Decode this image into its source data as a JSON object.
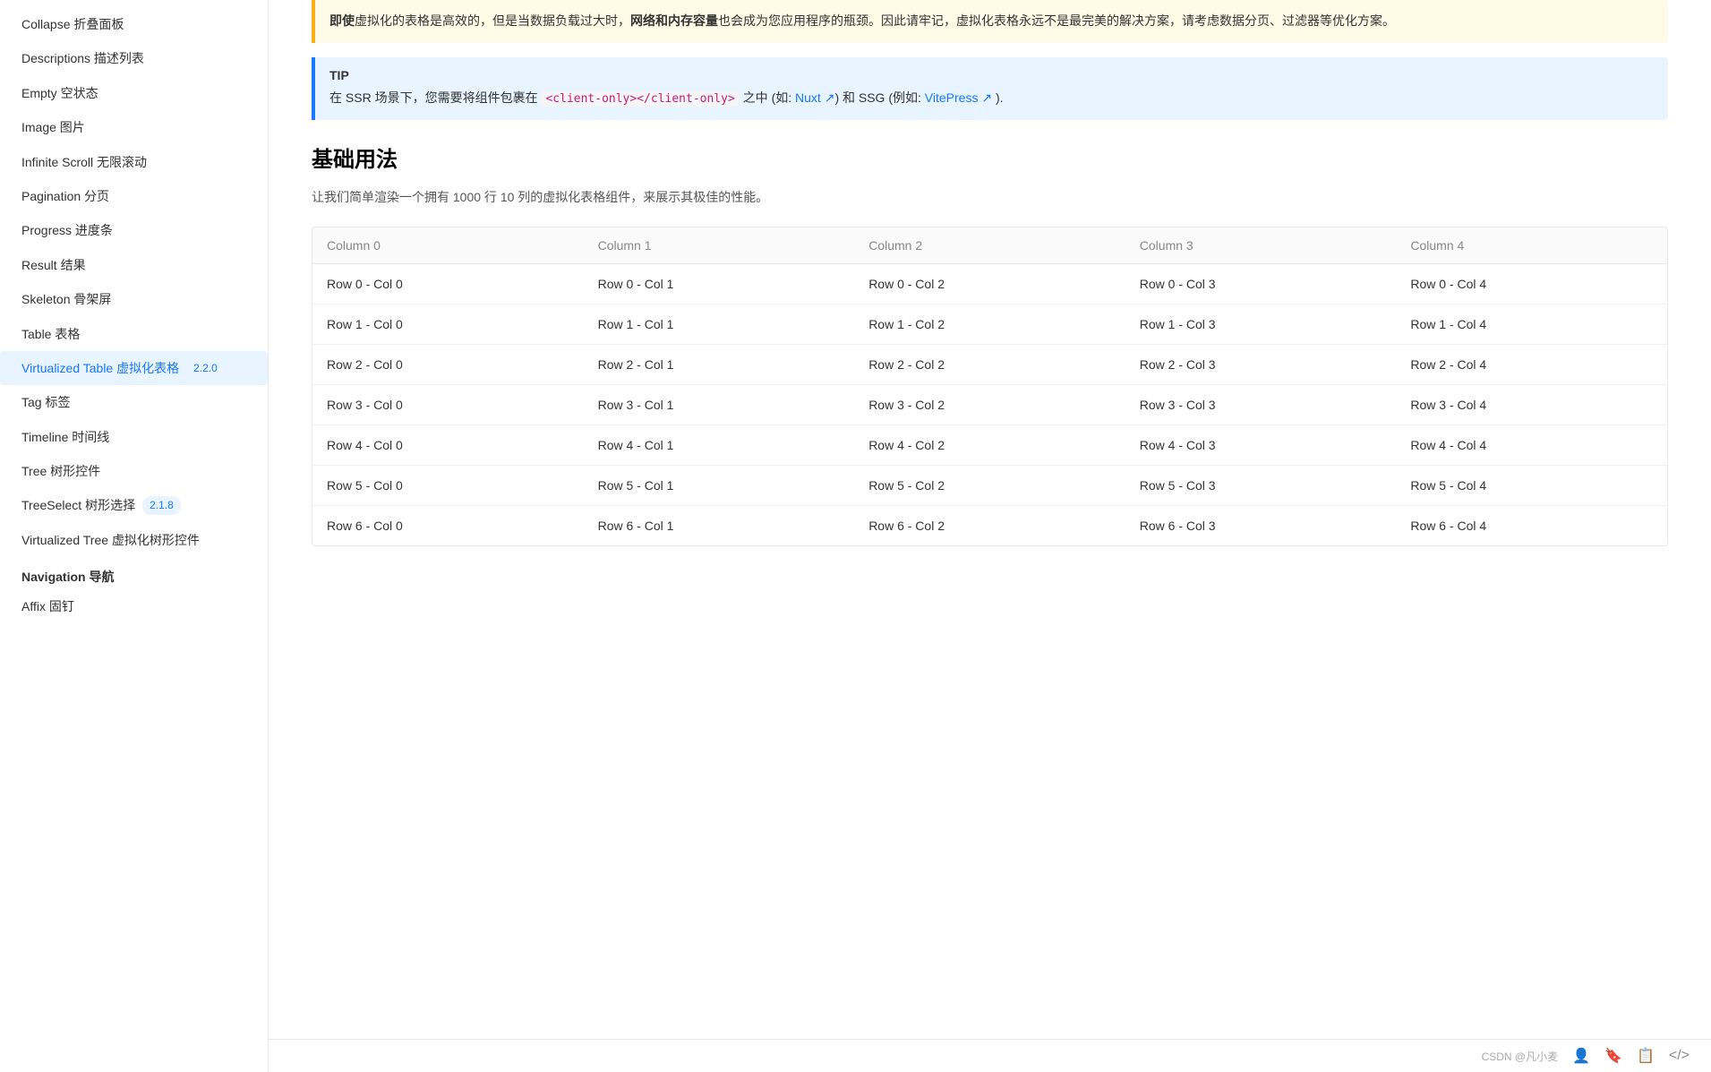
{
  "sidebar": {
    "items": [
      {
        "label": "Collapse 折叠面板",
        "active": false
      },
      {
        "label": "Descriptions 描述列表",
        "active": false
      },
      {
        "label": "Empty 空状态",
        "active": false
      },
      {
        "label": "Image 图片",
        "active": false
      },
      {
        "label": "Infinite Scroll 无限滚动",
        "active": false
      },
      {
        "label": "Pagination 分页",
        "active": false
      },
      {
        "label": "Progress 进度条",
        "active": false
      },
      {
        "label": "Result 结果",
        "active": false
      },
      {
        "label": "Skeleton 骨架屏",
        "active": false
      },
      {
        "label": "Table 表格",
        "active": false
      },
      {
        "label": "Virtualized Table 虚拟化表格",
        "active": true,
        "badge": "2.2.0"
      },
      {
        "label": "Tag 标签",
        "active": false
      },
      {
        "label": "Timeline 时间线",
        "active": false
      },
      {
        "label": "Tree 树形控件",
        "active": false
      },
      {
        "label": "TreeSelect 树形选择",
        "active": false,
        "badge": "2.1.8"
      },
      {
        "label": "Virtualized Tree 虚拟化树形控件",
        "active": false
      }
    ],
    "navigation_section": "Navigation 导航",
    "navigation_items": [
      {
        "label": "Affix 固钉",
        "active": false
      }
    ]
  },
  "main": {
    "warning_text": "即使虚拟化的表格是高效的，但是当数据负载过大时，网络和内存容量也会成为您应用程序的瓶颈。因此请牢记，虚拟化表格永远不是最完美的解决方案，请考虑数据分页、过滤器等优化方案。",
    "warning_bold_1": "网络和",
    "warning_bold_2": "内存容量",
    "tip_title": "TIP",
    "tip_text_1": "在 SSR 场景下，您需要将组件包裹在 ",
    "tip_code": "<client-only></client-only>",
    "tip_text_2": " 之中 (如: ",
    "tip_nuxt": "Nuxt",
    "tip_text_3": ") 和 SSG (例如: ",
    "tip_vitepress": "VitePress",
    "tip_text_4": ").",
    "section_title": "基础用法",
    "section_desc": "让我们简单渲染一个拥有 1000 行 10 列的虚拟化表格组件，来展示其极佳的性能。",
    "table": {
      "columns": [
        "Column 0",
        "Column 1",
        "Column 2",
        "Column 3",
        "Column 4"
      ],
      "rows": [
        [
          "Row 0 - Col 0",
          "Row 0 - Col 1",
          "Row 0 - Col 2",
          "Row 0 - Col 3",
          "Row 0 - Col 4"
        ],
        [
          "Row 1 - Col 0",
          "Row 1 - Col 1",
          "Row 1 - Col 2",
          "Row 1 - Col 3",
          "Row 1 - Col 4"
        ],
        [
          "Row 2 - Col 0",
          "Row 2 - Col 1",
          "Row 2 - Col 2",
          "Row 2 - Col 3",
          "Row 2 - Col 4"
        ],
        [
          "Row 3 - Col 0",
          "Row 3 - Col 1",
          "Row 3 - Col 2",
          "Row 3 - Col 3",
          "Row 3 - Col 4"
        ],
        [
          "Row 4 - Col 0",
          "Row 4 - Col 1",
          "Row 4 - Col 2",
          "Row 4 - Col 3",
          "Row 4 - Col 4"
        ],
        [
          "Row 5 - Col 0",
          "Row 5 - Col 1",
          "Row 5 - Col 2",
          "Row 5 - Col 3",
          "Row 5 - Col 4"
        ],
        [
          "Row 6 - Col 0",
          "Row 6 - Col 1",
          "Row 6 - Col 2",
          "Row 6 - Col 3",
          "Row 6 - Col 4"
        ]
      ]
    }
  },
  "bottom_bar": {
    "brand": "CSDN @凡小麦",
    "icons": [
      {
        "name": "person-icon",
        "symbol": "👤"
      },
      {
        "name": "bookmark-icon",
        "symbol": "🔖"
      },
      {
        "name": "copy-icon",
        "symbol": "📋"
      },
      {
        "name": "code-icon",
        "symbol": "</>"
      }
    ]
  }
}
